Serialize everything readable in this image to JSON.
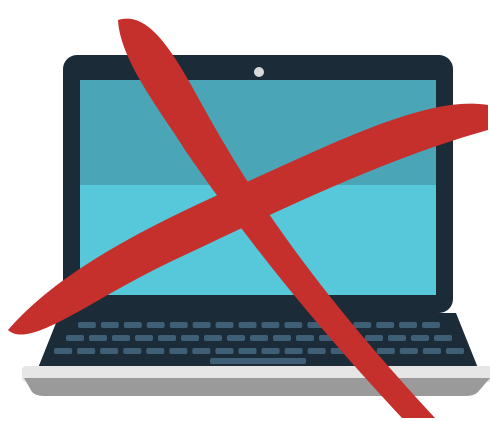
{
  "illustration": {
    "subject": "laptop-icon",
    "overlay": "red-x-icon",
    "colors": {
      "bezel": "#1b2b38",
      "screen": "#57c8d9",
      "screen_shade": "#4aa6b6",
      "camera": "#d9d9d9",
      "keyboard_deck": "#1b2b38",
      "keys": "#3f5f77",
      "base_top": "#e6e6e6",
      "base_bottom": "#9a9a9a",
      "cross": "#c5302d"
    }
  }
}
